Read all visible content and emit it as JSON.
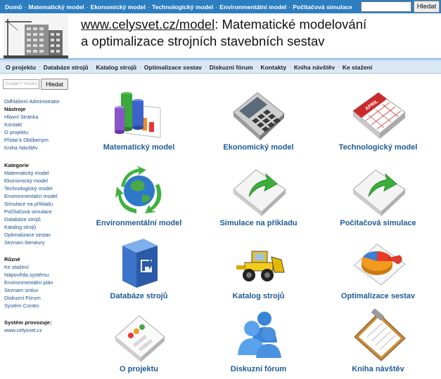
{
  "topnav": {
    "items": [
      "Domů",
      "Matematický model",
      "Ekonomický model",
      "Technologický model",
      "Environmentální model",
      "Počítačová simulace"
    ],
    "search_button": "Hledat"
  },
  "header": {
    "url": "www.celysvet.cz/model",
    "title_line1": ": Matematické modelování",
    "title_line2": "a optimalizace strojních stavebních sestav"
  },
  "mainnav": {
    "items": [
      "O projektu",
      "Databáze strojů",
      "Katalog strojů",
      "Optimalizace sestav",
      "Diskuzní fórum",
      "Kontakty",
      "Kniha návštěv",
      "Ke stažení"
    ]
  },
  "sidebar": {
    "google_placeholder": "Google™ Vlastní",
    "search_button": "Hledat",
    "logout": "Odhlášení Administrator",
    "tools_head": "Nástroje",
    "tools": [
      "Hlavní Stránka",
      "Kontakt",
      "O projektu",
      "Přidat k Oblíbeným",
      "Kniha Návštěv"
    ],
    "category_head": "Kategorie",
    "categories": [
      "Matematický model",
      "Ekonomický model",
      "Technologický model",
      "Environmentální model",
      "Simulace na příkladu",
      "Počítačová simulace",
      "Databáze strojů",
      "Katalog strojů",
      "Optimalizace sestav",
      "Seznam literatury"
    ],
    "misc_head": "Různé",
    "misc": [
      "Ke stažení",
      "Nápověda systému",
      "Environmentální plán",
      "Seznam smluv",
      "Diskuzní Fórum",
      "Systém Contec"
    ],
    "operator_head": "Systém provozuje:",
    "operator": "www.celysvet.cz"
  },
  "tiles": [
    {
      "label": "Matematický model",
      "icon": "chart-icon"
    },
    {
      "label": "Ekonomický model",
      "icon": "calculator-icon"
    },
    {
      "label": "Technologický model",
      "icon": "calendar-icon"
    },
    {
      "label": "Environmentální model",
      "icon": "globe-recycle-icon"
    },
    {
      "label": "Simulace na příkladu",
      "icon": "document-arrow-icon"
    },
    {
      "label": "Počítačová simulace",
      "icon": "document-arrow-icon"
    },
    {
      "label": "Databáze strojů",
      "icon": "database-box-icon"
    },
    {
      "label": "Katalog strojů",
      "icon": "bulldozer-icon"
    },
    {
      "label": "Optimalizace sestav",
      "icon": "pie-chart-icon"
    },
    {
      "label": "O projektu",
      "icon": "form-window-icon"
    },
    {
      "label": "Diskuzní fórum",
      "icon": "users-icon"
    },
    {
      "label": "Kniha návštěv",
      "icon": "clipboard-icon"
    }
  ],
  "calendar_label": "APRIL",
  "colors": {
    "topbar": "#2d7ec0",
    "nav_bg": "#dbe9f5",
    "link": "#1a4f8a",
    "tile_label": "#1e5a96"
  }
}
